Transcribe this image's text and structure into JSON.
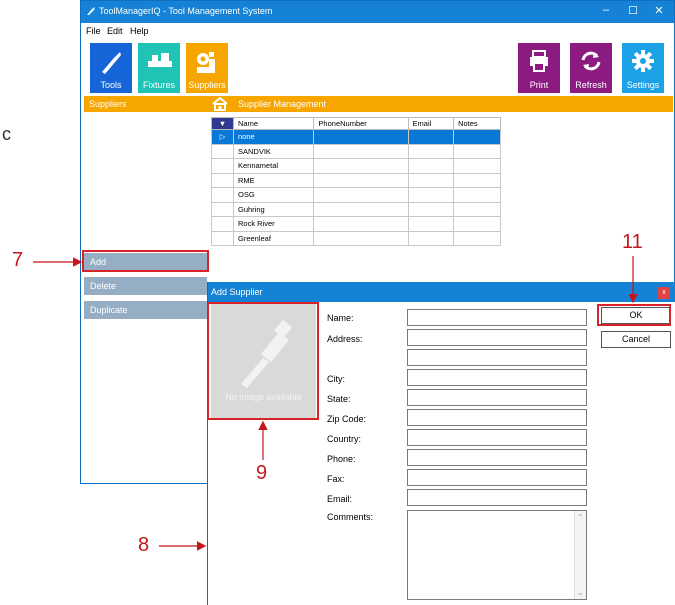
{
  "window": {
    "title": "ToolManagerIQ - Tool Management System",
    "controls": [
      "–",
      "☐",
      "✕"
    ]
  },
  "menu": [
    "File",
    "Edit",
    "Help"
  ],
  "toolbar": {
    "left": [
      {
        "label": "Tools",
        "color": "#1565d8"
      },
      {
        "label": "Fixtures",
        "color": "#20c4b4"
      },
      {
        "label": "Suppliers",
        "color": "#f7a600"
      }
    ],
    "right": [
      {
        "label": "Print",
        "color": "#8b1b80"
      },
      {
        "label": "Refresh",
        "color": "#8b1b80"
      },
      {
        "label": "Settings",
        "color": "#1ca0e6"
      }
    ]
  },
  "sidebar": {
    "header": "Suppliers",
    "buttons": [
      "Add",
      "Delete",
      "Duplicate"
    ]
  },
  "main": {
    "header": "Supplier Management"
  },
  "grid": {
    "columns": [
      "Name",
      "PhoneNumber",
      "Email",
      "Notes"
    ],
    "rows": [
      "none",
      "SANDVIK",
      "Kennametal",
      "RME",
      "OSG",
      "Guhring",
      "Rock River",
      "Greenleaf"
    ],
    "selected_index": 0
  },
  "dialog": {
    "title": "Add Supplier",
    "close": "x",
    "image_placeholder": "No image available",
    "fields": [
      "Name:",
      "Address:",
      "",
      "City:",
      "State:",
      "Zip Code:",
      "Country:",
      "Phone:",
      "Fax:",
      "Email:"
    ],
    "comments_label": "Comments:",
    "ok": "OK",
    "cancel": "Cancel"
  },
  "annotations": {
    "add": "7",
    "dialog": "8",
    "image": "9",
    "ok": "11"
  },
  "side_letter": "c",
  "colors": {
    "title_bar": "#1582d6",
    "orange": "#f7a600",
    "red": "#d8232a",
    "side_button": "#96aec4",
    "selection": "#0a78d7"
  }
}
